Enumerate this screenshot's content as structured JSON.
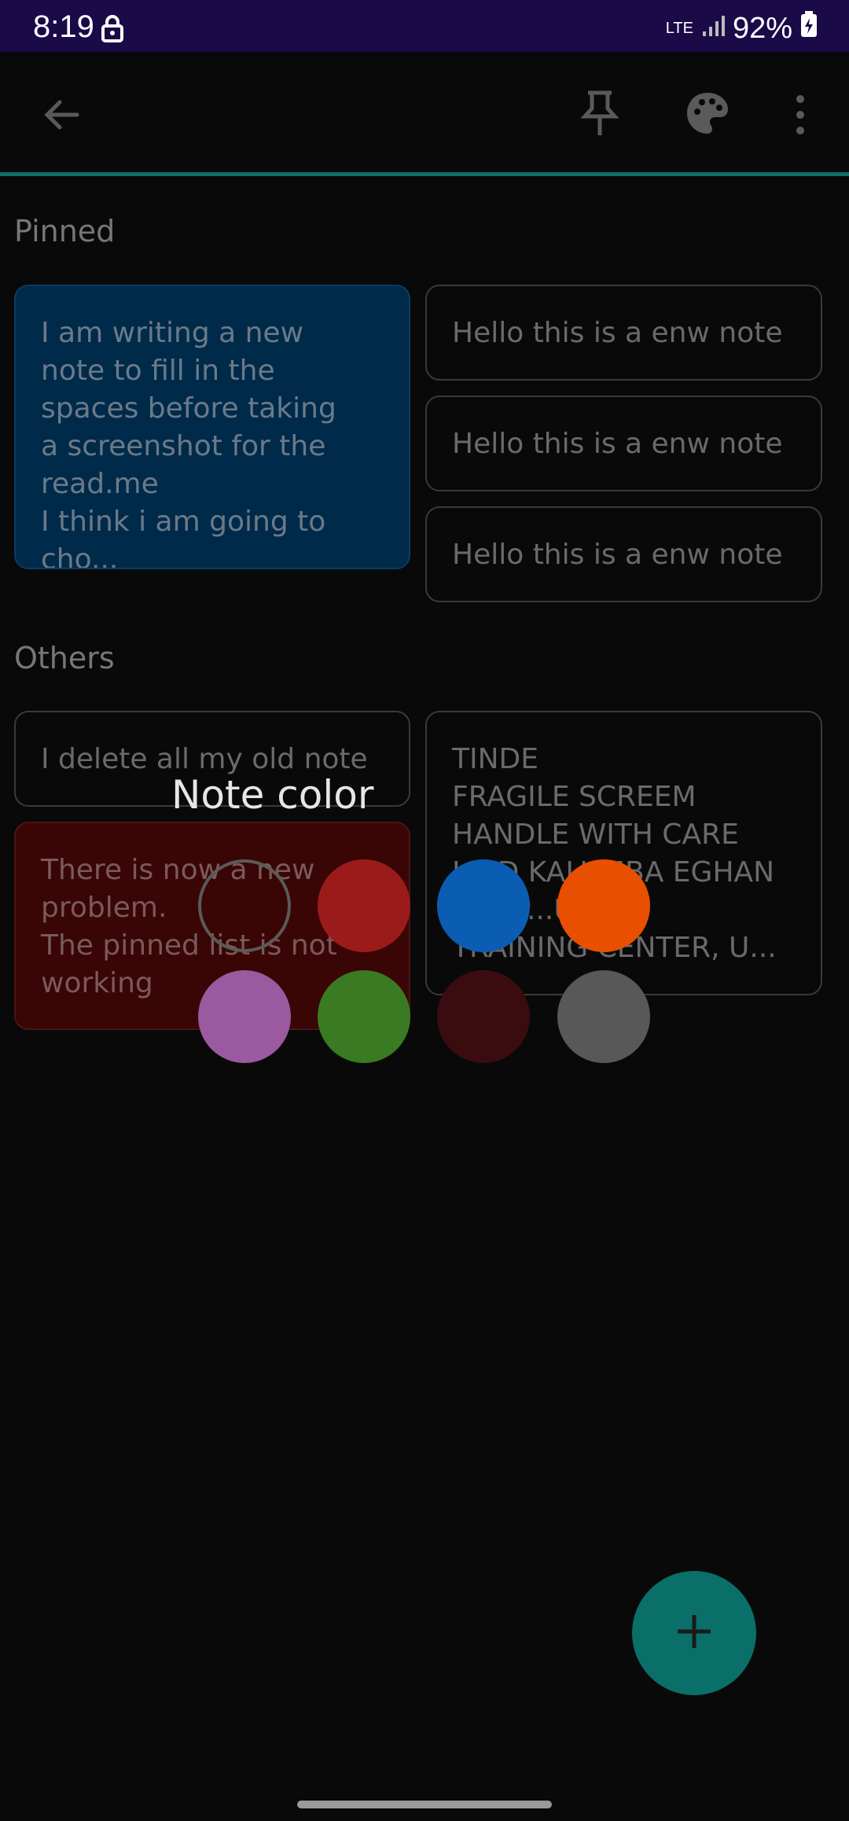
{
  "status_bar": {
    "time": "8:19",
    "network": "LTE",
    "battery": "92%"
  },
  "toolbar": {
    "back_icon": "arrow-back-icon",
    "pin_icon": "pin-icon",
    "palette_icon": "palette-icon",
    "more_icon": "more-vert-icon"
  },
  "pinned": {
    "title": "Pinned",
    "notes": [
      {
        "text": "I am writing a new\nnote to fill in the\nspaces before taking\na screenshot for the\nread.me\nI think i am going to cho..."
      },
      {
        "text": "Hello this is a enw note"
      },
      {
        "text": "Hello this is a enw note"
      },
      {
        "text": "Hello this is a enw note"
      }
    ]
  },
  "others": {
    "title": "Others",
    "notes": [
      {
        "text": "I delete all my old note"
      },
      {
        "text": "There is now a new\nproblem.\nThe pinned list is not\nworking"
      },
      {
        "text": "TINDE\nFRAGILE SCREEM\nHANDLE WITH CARE\nLIND KALUMBA EGHAN\nS...PP...UD\nTRAINING CENTER, U..."
      }
    ]
  },
  "color_dialog": {
    "title": "Note color",
    "swatches": [
      {
        "name": "default",
        "color": "transparent"
      },
      {
        "name": "red",
        "color": "#9b1b1b"
      },
      {
        "name": "blue",
        "color": "#0a5db3"
      },
      {
        "name": "orange",
        "color": "#e84f00"
      },
      {
        "name": "purple",
        "color": "#9b59a0"
      },
      {
        "name": "green",
        "color": "#3a7a22"
      },
      {
        "name": "maroon",
        "color": "#3a0c10"
      },
      {
        "name": "grey",
        "color": "#585858"
      }
    ]
  },
  "fab": {
    "icon": "plus-icon"
  }
}
